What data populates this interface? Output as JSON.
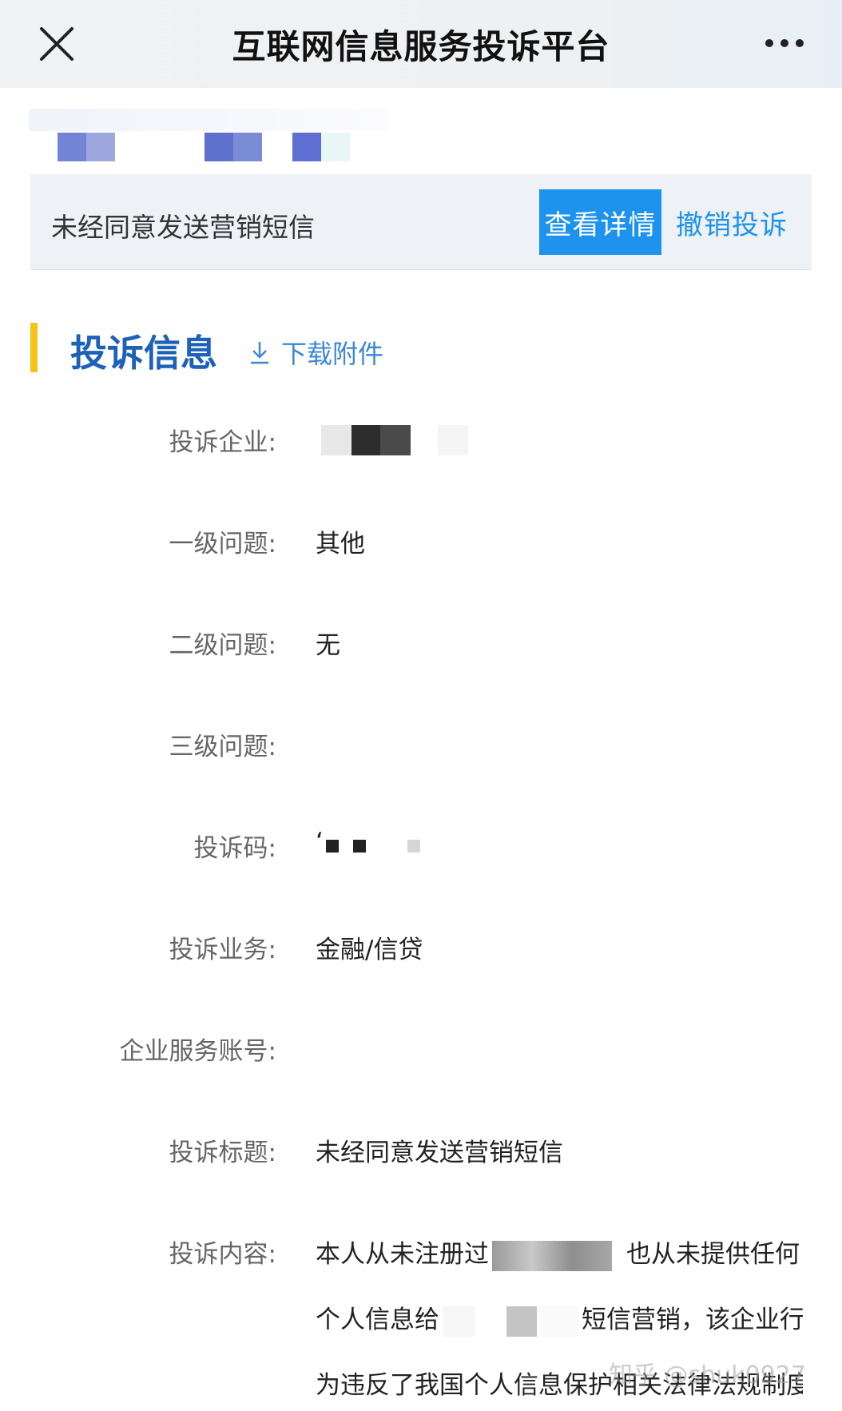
{
  "app": {
    "title": "互联网信息服务投诉平台"
  },
  "card": {
    "complaint_title": "未经同意发送营销短信",
    "view_detail": "查看详情",
    "revoke": "撤销投诉"
  },
  "section": {
    "title": "投诉信息",
    "download": "下载附件"
  },
  "fields": {
    "enterprise_label": "投诉企业:",
    "level1_label": "一级问题:",
    "level1_value": "其他",
    "level2_label": "二级问题:",
    "level2_value": "无",
    "level3_label": "三级问题:",
    "level3_value": "",
    "code_label": "投诉码:",
    "code_value": "‘",
    "business_label": "投诉业务:",
    "business_value": "金融/信贷",
    "account_label": "企业服务账号:",
    "account_value": "",
    "subject_label": "投诉标题:",
    "subject_value": "未经同意发送营销短信",
    "content_label": "投诉内容:"
  },
  "content": {
    "line1_a": "本人从未注册过",
    "line1_b": "也从未提供任何",
    "line2_a": "个人信息给",
    "line2_b": "短信营销，该企业行",
    "line3": "为违反了我国个人信息保护相关法律法规制度"
  },
  "watermark": "知乎 @shuk0927",
  "icons": {
    "close": "close-icon",
    "more": "more-icon",
    "download": "download-icon"
  },
  "colors": {
    "primary": "#1e93ee",
    "section_title": "#1d62b8",
    "accent_bar": "#f5c21a"
  }
}
